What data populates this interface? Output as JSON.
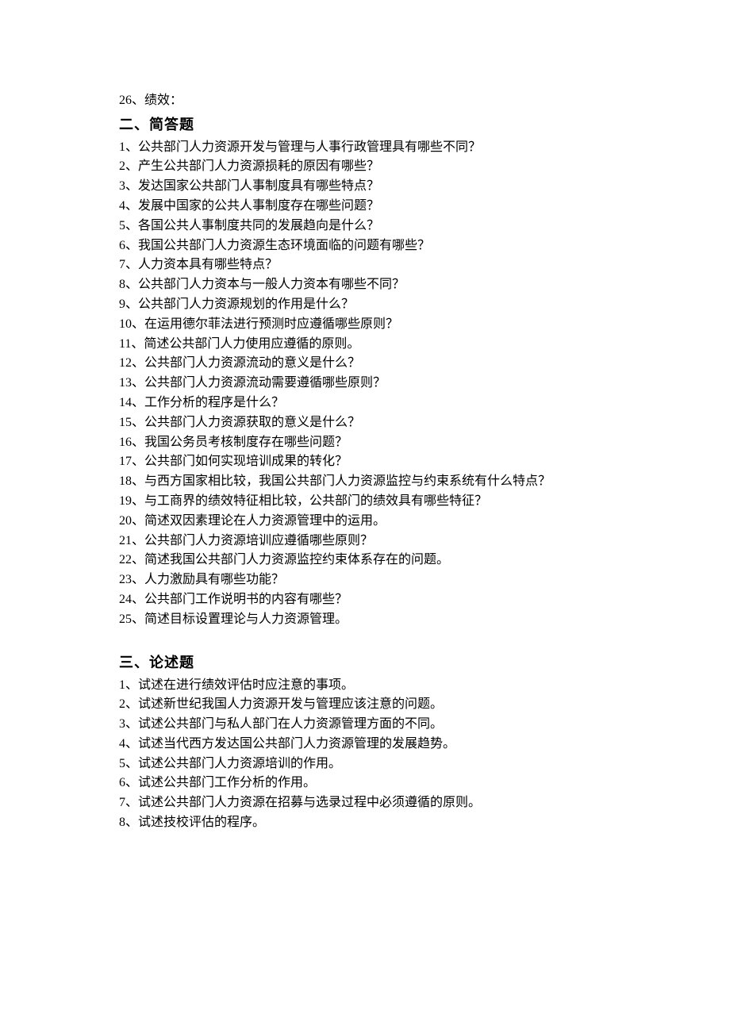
{
  "intro_item": "26、绩效：",
  "section2": {
    "heading": " 二、简答题",
    "items": [
      "1、公共部门人力资源开发与管理与人事行政管理具有哪些不同？",
      "2、产生公共部门人力资源损耗的原因有哪些？",
      "3、发达国家公共部门人事制度具有哪些特点？",
      "4、发展中国家的公共人事制度存在哪些问题？",
      "5、各国公共人事制度共同的发展趋向是什么？",
      "6、我国公共部门人力资源生态环境面临的问题有哪些？",
      "7、人力资本具有哪些特点？",
      "8、公共部门人力资本与一般人力资本有哪些不同？",
      "9、公共部门人力资源规划的作用是什么？",
      "10、在运用德尔菲法进行预测时应遵循哪些原则？",
      "11、简述公共部门人力使用应遵循的原则。",
      "12、公共部门人力资源流动的意义是什么？",
      "13、公共部门人力资源流动需要遵循哪些原则？",
      "14、工作分析的程序是什么？",
      "15、公共部门人力资源获取的意义是什么？",
      "16、我国公务员考核制度存在哪些问题？",
      "17、公共部门如何实现培训成果的转化？",
      "18、与西方国家相比较，我国公共部门人力资源监控与约束系统有什么特点？",
      "19、与工商界的绩效特征相比较，公共部门的绩效具有哪些特征？",
      "20、简述双因素理论在人力资源管理中的运用。",
      "21、公共部门人力资源培训应遵循哪些原则？",
      "22、简述我国公共部门人力资源监控约束体系存在的问题。",
      "23、人力激励具有哪些功能？",
      "24、公共部门工作说明书的内容有哪些？",
      "25、简述目标设置理论与人力资源管理。"
    ]
  },
  "section3": {
    "heading": " 三、论述题",
    "items": [
      "1、试述在进行绩效评估时应注意的事项。",
      "2、试述新世纪我国人力资源开发与管理应该注意的问题。",
      "3、试述公共部门与私人部门在人力资源管理方面的不同。",
      "4、试述当代西方发达国公共部门人力资源管理的发展趋势。",
      "5、试述公共部门人力资源培训的作用。",
      "6、试述公共部门工作分析的作用。",
      "7、试述公共部门人力资源在招募与选录过程中必须遵循的原则。",
      "8、试述技校评估的程序。"
    ]
  }
}
